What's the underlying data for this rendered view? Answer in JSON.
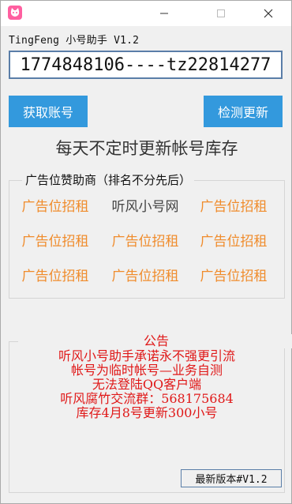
{
  "window": {
    "title": "TingFeng 小号助手 V1.2",
    "controls": {
      "minimize": "—",
      "maximize": "☐",
      "close": "✕"
    }
  },
  "account": {
    "value": "1774848106----tz22814277"
  },
  "buttons": {
    "get_account": "获取账号",
    "check_update": "检测更新"
  },
  "stock_text": "每天不定时更新帐号库存",
  "ads": {
    "legend": "广告位赞助商（排名不分先后）",
    "rows": [
      [
        "广告位招租",
        "听风小号网",
        "广告位招租"
      ],
      [
        "广告位招租",
        "广告位招租",
        "广告位招租"
      ],
      [
        "广告位招租",
        "广告位招租",
        "广告位招租"
      ]
    ]
  },
  "notice": {
    "legend": "公告",
    "lines": [
      "听风小号助手承诺永不强更引流",
      "帐号为临时帐号—业务自测",
      "无法登陆QQ客户端",
      "听风腐竹交流群：568175684",
      "库存4月8号更新300小号"
    ]
  },
  "version_button": "最新版本#V1.2",
  "colors": {
    "accent": "#3399dd",
    "ad_text": "#f08c2c",
    "notice_text": "#e01818",
    "input_border": "#5a7ea8"
  }
}
